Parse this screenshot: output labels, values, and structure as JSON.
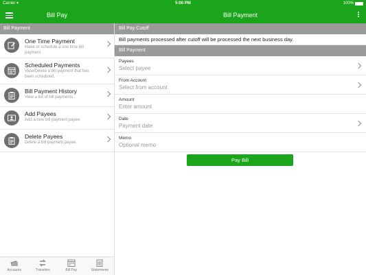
{
  "status_bar": {
    "carrier": "Carrier",
    "time": "5:00 PM",
    "battery": "100%"
  },
  "nav": {
    "left_title": "Bill Pay",
    "right_title": "Bill Payment"
  },
  "sidebar": {
    "header": "Bill Payment",
    "items": [
      {
        "title": "One Time Payment",
        "subtitle": "Make or schedule a one time bill payment.",
        "icon": "edit-icon"
      },
      {
        "title": "Scheduled Payments",
        "subtitle": "View/Delete a bill payment that has been scheduled.",
        "icon": "calendar-icon"
      },
      {
        "title": "Bill Payment History",
        "subtitle": "View a list of bill payments.",
        "icon": "clipboard-icon"
      },
      {
        "title": "Add Payees",
        "subtitle": "Add a new bill payment payee.",
        "icon": "contact-card-icon"
      },
      {
        "title": "Delete Payees",
        "subtitle": "Delete a bill payment payee.",
        "icon": "clipboard-delete-icon"
      }
    ]
  },
  "tabs": [
    {
      "label": "Accounts",
      "icon": "cards-icon"
    },
    {
      "label": "Transfers",
      "icon": "transfer-arrows-icon"
    },
    {
      "label": "Bill Pay",
      "icon": "calendar-icon"
    },
    {
      "label": "Statements",
      "icon": "statement-icon"
    }
  ],
  "main": {
    "cutoff_header": "Bill Pay Cutoff",
    "cutoff_text": "Bill payments processed after cutoff will be processed the next business day.",
    "form_header": "Bill Payment",
    "fields": {
      "payees": {
        "label": "Payees",
        "placeholder": "Select payee",
        "value": ""
      },
      "from_account": {
        "label": "From Account",
        "placeholder": "Select from account",
        "value": ""
      },
      "amount": {
        "label": "Amount",
        "placeholder": "Enter amount",
        "value": ""
      },
      "date": {
        "label": "Date",
        "placeholder": "Payment date",
        "value": ""
      },
      "memo": {
        "label": "Memo",
        "placeholder": "Optional memo",
        "value": ""
      }
    },
    "pay_button": "Pay Bill"
  },
  "colors": {
    "brand_green": "#1aa51a",
    "section_gray": "#9a9a9a",
    "icon_gray": "#6e6e6e"
  }
}
